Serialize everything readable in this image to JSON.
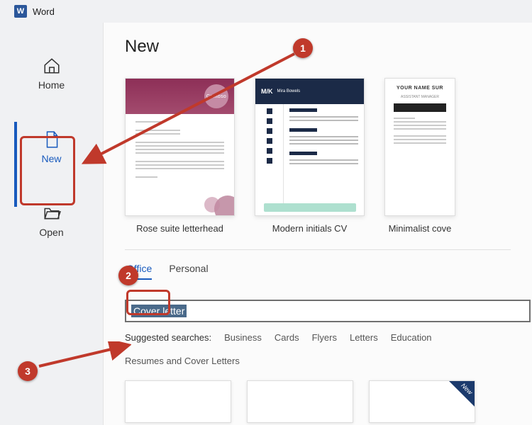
{
  "app": {
    "logo_text": "W",
    "title": "Word"
  },
  "sidebar": {
    "items": [
      {
        "label": "Home"
      },
      {
        "label": "New"
      },
      {
        "label": "Open"
      }
    ]
  },
  "main": {
    "heading": "New",
    "templates": [
      {
        "label": "Rose suite letterhead",
        "brand": "Contoso"
      },
      {
        "label": "Modern initials CV",
        "initials": "M/K",
        "name": "Mira Bowels"
      },
      {
        "label": "Minimalist cove",
        "header": "YOUR NAME SUR"
      }
    ],
    "tabs": [
      {
        "label": "Office",
        "active": true
      },
      {
        "label": "Personal",
        "active": false
      }
    ],
    "search_value": "Cover letter",
    "suggested_label": "Suggested searches:",
    "suggested": [
      "Business",
      "Cards",
      "Flyers",
      "Letters",
      "Education",
      "Resumes and Cover Letters"
    ],
    "ribbon_label": "New"
  },
  "annotations": {
    "numbers": [
      "1",
      "2",
      "3"
    ]
  }
}
